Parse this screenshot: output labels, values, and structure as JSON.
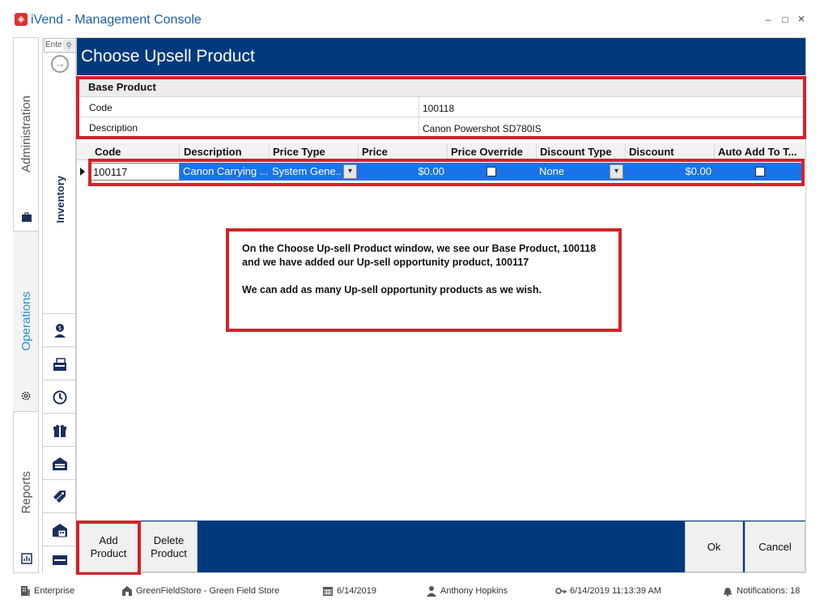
{
  "window": {
    "title": "iVend - Management Console",
    "controls": {
      "minimize": "–",
      "maximize": "□",
      "close": "×"
    }
  },
  "left_nav": {
    "tabs": [
      {
        "label": "Administration",
        "icon": "briefcase-icon"
      },
      {
        "label": "Operations",
        "icon": "gear-icon",
        "active": true
      },
      {
        "label": "Reports",
        "icon": "report-icon"
      }
    ]
  },
  "icon_column": {
    "search_placeholder": "Ente",
    "section_label": "Inventory",
    "items": [
      "price-person-icon",
      "register-icon",
      "clock-icon",
      "gift-icon",
      "warehouse-icon",
      "tags-icon",
      "store-calc-icon",
      "gift-card-icon"
    ]
  },
  "page": {
    "title": "Choose Upsell Product"
  },
  "base_product": {
    "header": "Base Product",
    "rows": [
      {
        "key": "Code",
        "value": "100118"
      },
      {
        "key": "Description",
        "value": "Canon Powershot SD780IS"
      }
    ]
  },
  "grid": {
    "columns": [
      "Code",
      "Description",
      "Price Type",
      "Price",
      "Price Override",
      "Discount Type",
      "Discount",
      "Auto Add To T..."
    ],
    "rows": [
      {
        "code": "100117",
        "description": "Canon Carrying ...",
        "price_type": "System Gene...",
        "price": "$0.00",
        "price_override": false,
        "discount_type": "None",
        "discount": "$0.00",
        "auto_add": false
      }
    ]
  },
  "callout": {
    "line1": "On the Choose Up-sell Product window, we see our Base Product, 100118 and we have added our Up-sell opportunity product, 100117",
    "line2": "We can add as many Up-sell opportunity products as we wish."
  },
  "actions": {
    "add_product": "Add Product",
    "delete_product": "Delete Product",
    "ok": "Ok",
    "cancel": "Cancel"
  },
  "status_bar": {
    "company": "Enterprise",
    "store": "GreenFieldStore - Green Field Store",
    "date": "6/14/2019",
    "user": "Anthony Hopkins",
    "datetime": "6/14/2019 11:13:39 AM",
    "notifications": "Notifications: 18"
  },
  "colors": {
    "header_blue": "#003a7d",
    "selection_blue": "#1a73e8",
    "annotation_red": "#d2232a",
    "title_blue": "#1f5fa8",
    "operations_blue": "#2a8fd0"
  }
}
